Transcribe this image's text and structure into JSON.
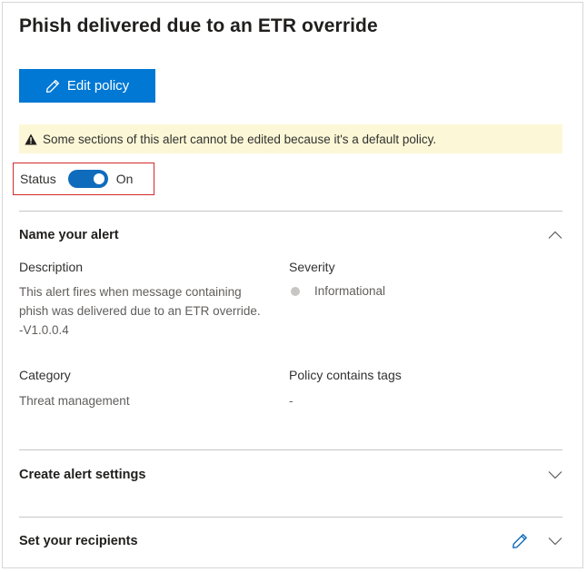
{
  "panel": {
    "title": "Phish delivered due to an ETR override",
    "edit_button": "Edit policy",
    "warning": "Some sections of this alert cannot be edited because it's a default policy.",
    "status": {
      "label": "Status",
      "state_text": "On",
      "on": true
    }
  },
  "sections": {
    "name_alert": {
      "title": "Name your alert",
      "expanded": true,
      "description_label": "Description",
      "description_value": "This alert fires when message containing phish was delivered due to an ETR override. -V1.0.0.4",
      "severity_label": "Severity",
      "severity_value": "Informational",
      "category_label": "Category",
      "category_value": "Threat management",
      "tags_label": "Policy contains tags",
      "tags_value": "-"
    },
    "alert_settings": {
      "title": "Create alert settings",
      "expanded": false
    },
    "recipients": {
      "title": "Set your recipients",
      "expanded": false
    }
  },
  "icons": {
    "edit": "pencil-icon",
    "warning": "warning-triangle-icon",
    "collapse": "chevron-up-icon",
    "expand": "chevron-down-icon",
    "severity": "status-dot-icon"
  },
  "colors": {
    "accent": "#0078d4",
    "toggle_on": "#0f6cbd",
    "warning_bg": "#fcf8d7",
    "highlight_border": "#d22a2a",
    "severity_dot": "#c8c6c4"
  }
}
